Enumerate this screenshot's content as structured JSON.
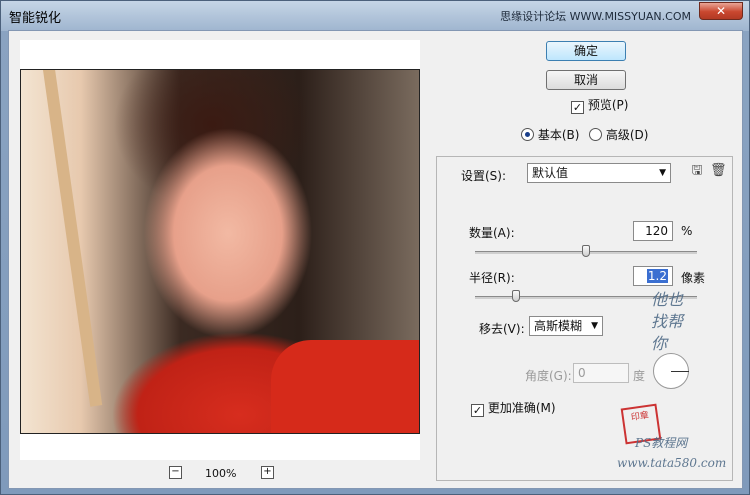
{
  "window": {
    "title": "智能锐化",
    "site_text": "思缘设计论坛 WWW.MISSYUAN.COM",
    "close_symbol": "✕"
  },
  "preview": {
    "zoom_out": "−",
    "zoom_in": "+",
    "zoom_level": "100%"
  },
  "actions": {
    "ok": "确定",
    "cancel": "取消",
    "preview_label": "预览(P)",
    "preview_checked": true
  },
  "mode": {
    "basic": "基本(B)",
    "advanced": "高级(D)",
    "selected": "basic"
  },
  "settings": {
    "label": "设置(S):",
    "value": "默认值",
    "save_icon": "save-icon",
    "delete_icon": "trash-icon"
  },
  "amount": {
    "label": "数量(A):",
    "value": "120",
    "unit": "%",
    "slider_fraction": 0.5
  },
  "radius": {
    "label": "半径(R):",
    "value": "1.2",
    "unit": "像素",
    "slider_fraction": 0.185
  },
  "remove": {
    "label": "移去(V):",
    "value": "高斯模糊"
  },
  "angle": {
    "label": "角度(G):",
    "value": "0",
    "unit": "度"
  },
  "more_accurate": {
    "label": "更加准确(M)",
    "checked": true
  },
  "watermarks": {
    "calligraphy": "他也找帮你",
    "stamp": "印章",
    "ps_site": "PS教程网",
    "url": "www.tata580.com"
  },
  "colors": {
    "accent": "#3c7fb1",
    "close_red": "#c9472f"
  }
}
